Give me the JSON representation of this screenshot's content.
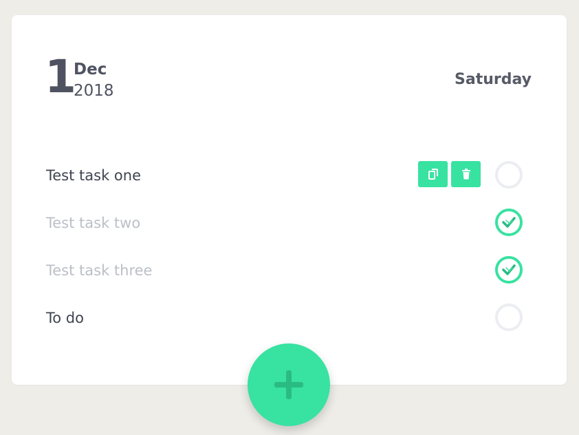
{
  "header": {
    "day": "1",
    "month": "Dec",
    "year": "2018",
    "weekday": "Saturday"
  },
  "tasks": [
    {
      "label": "Test task one",
      "done": false,
      "show_actions": true
    },
    {
      "label": "Test task two",
      "done": true,
      "show_actions": false
    },
    {
      "label": "Test task three",
      "done": true,
      "show_actions": false
    },
    {
      "label": "To do",
      "done": false,
      "show_actions": false
    }
  ],
  "icons": {
    "copy": "copy-icon",
    "delete": "trash-icon",
    "check": "checkmark-icon",
    "add": "plus-icon"
  },
  "colors": {
    "accent": "#38e2a1",
    "accent_dark": "#2abb84",
    "text": "#3f4450",
    "text_done": "#bbbfc6",
    "background": "#eeede8"
  }
}
